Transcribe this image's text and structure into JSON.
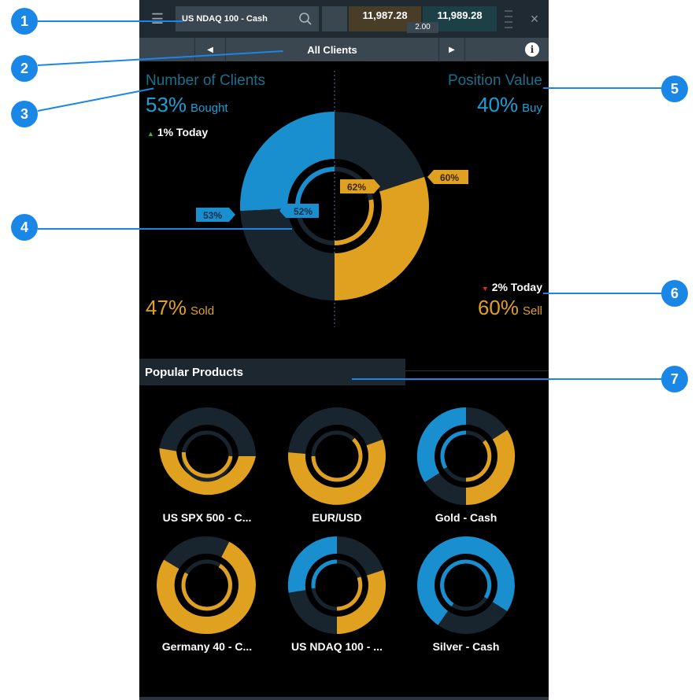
{
  "topbar": {
    "instrument": "US NDAQ 100 - Cash",
    "sell_price": "11,987.28",
    "buy_price": "11,989.28",
    "spread": "2.00",
    "close": "×",
    "menu": "☰"
  },
  "subbar": {
    "label": "All Clients",
    "prev": "◀",
    "next": "▶",
    "info": "i"
  },
  "sentiment": {
    "clients_title": "Number of Clients",
    "bought_pct": "53%",
    "bought_label": "Bought",
    "today_up": "1% Today",
    "sold_pct": "47%",
    "sold_label": "Sold",
    "position_title": "Position Value",
    "buy_pct": "40%",
    "buy_label": "Buy",
    "today_down": "2% Today",
    "sell_pct": "60%",
    "sell_label": "Sell",
    "tag_outer_left": "53%",
    "tag_inner_left": "52%",
    "tag_inner_right": "62%",
    "tag_outer_right": "60%",
    "up_arrow": "▲",
    "down_arrow": "▼"
  },
  "popular": {
    "title": "Popular Products",
    "items": [
      {
        "name": "US SPX 500 - C..."
      },
      {
        "name": "EUR/USD"
      },
      {
        "name": "Gold - Cash"
      },
      {
        "name": "Germany 40 - C..."
      },
      {
        "name": "US NDAQ 100 - ..."
      },
      {
        "name": "Silver - Cash"
      }
    ]
  },
  "callouts": [
    "1",
    "2",
    "3",
    "4",
    "5",
    "6",
    "7"
  ],
  "colors": {
    "blue": "#1a8fd0",
    "gold": "#e0a020",
    "dark": "#18252f",
    "callout": "#1a87e6",
    "teal_text": "#1aa0d8"
  }
}
